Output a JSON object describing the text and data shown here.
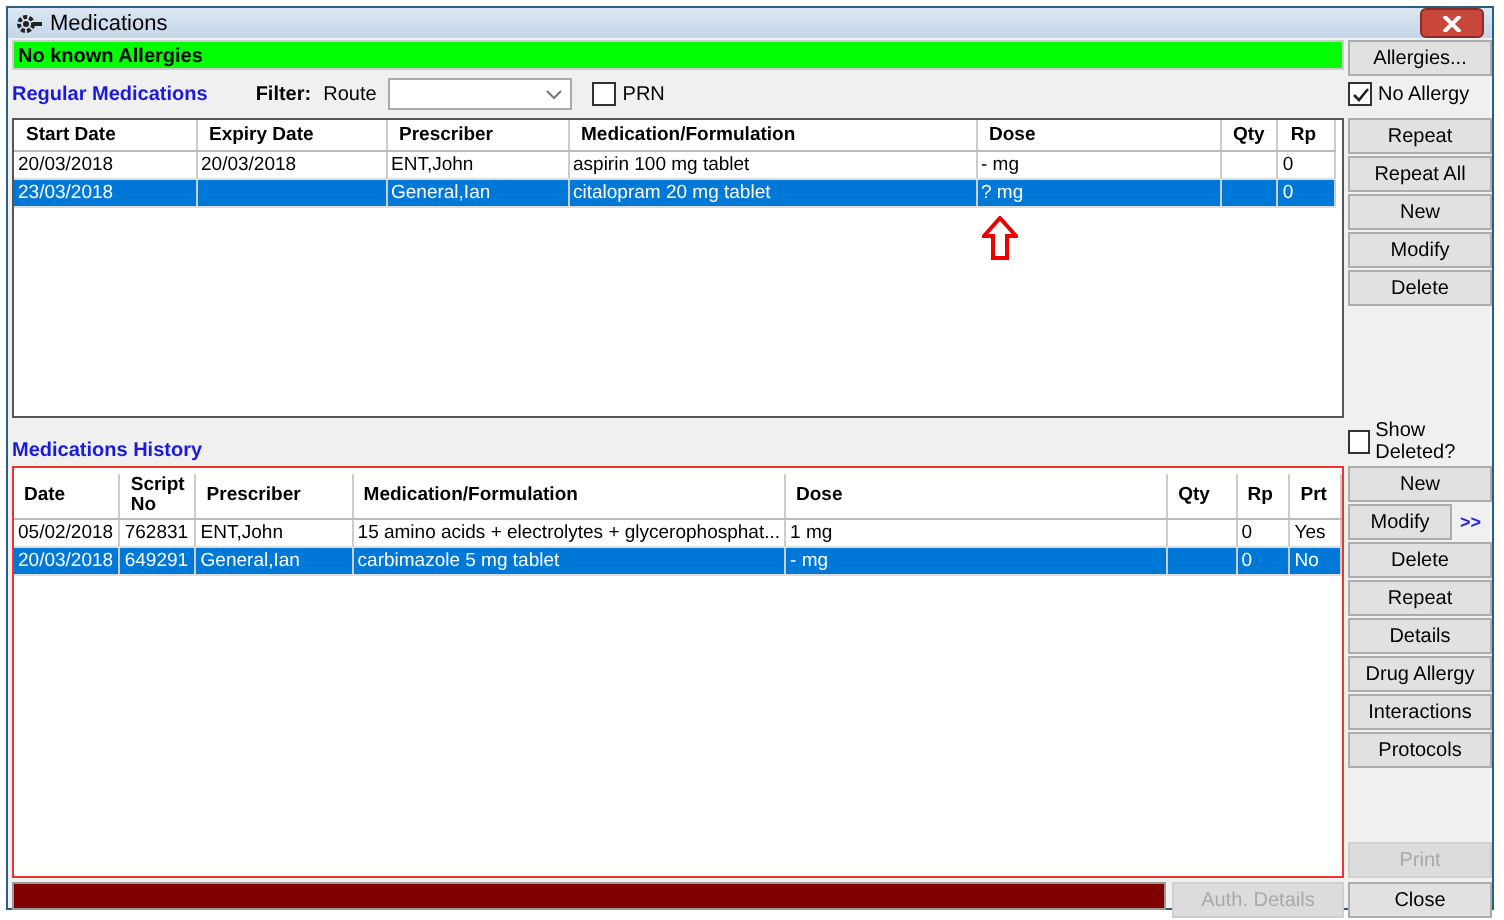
{
  "window": {
    "title": "Medications"
  },
  "allergy_status": "No known Allergies",
  "regular_medications": {
    "title": "Regular Medications",
    "filter_label": "Filter:",
    "route_label": "Route",
    "prn": {
      "label": "PRN",
      "checked": false
    },
    "columns": [
      "Start Date",
      "Expiry Date",
      "Prescriber",
      "Medication/Formulation",
      "Dose",
      "Qty",
      "Rp"
    ],
    "rows": [
      {
        "cells": [
          "20/03/2018",
          "20/03/2018",
          "ENT,John",
          "aspirin 100 mg tablet",
          "- mg",
          "",
          "0"
        ],
        "selected": false
      },
      {
        "cells": [
          "23/03/2018",
          "",
          "General,Ian",
          "citalopram 20 mg tablet",
          "? mg",
          "",
          "0"
        ],
        "selected": true
      }
    ]
  },
  "side_top": {
    "allergies_button": {
      "label": "Allergies...",
      "disabled": false
    },
    "no_allergy": {
      "label": "No Allergy",
      "checked": true
    },
    "buttons": [
      {
        "label": "Repeat",
        "disabled": false
      },
      {
        "label": "Repeat All",
        "disabled": false
      },
      {
        "label": "New",
        "disabled": false
      },
      {
        "label": "Modify",
        "disabled": false
      },
      {
        "label": "Delete",
        "disabled": false
      }
    ]
  },
  "medications_history": {
    "title": "Medications History",
    "show_deleted": {
      "label": "Show Deleted?",
      "checked": false
    },
    "columns": [
      "Date",
      "Script No",
      "Prescriber",
      "Medication/Formulation",
      "Dose",
      "Qty",
      "Rp",
      "Prt"
    ],
    "rows": [
      {
        "cells": [
          "05/02/2018",
          "762831",
          "ENT,John",
          "15 amino acids + electrolytes + glycerophosphat...",
          "1 mg",
          "",
          "0",
          "Yes"
        ],
        "selected": false
      },
      {
        "cells": [
          "20/03/2018",
          "649291",
          "General,Ian",
          "carbimazole 5 mg tablet",
          "- mg",
          "",
          "0",
          "No"
        ],
        "selected": true
      }
    ]
  },
  "side_bottom": {
    "buttons": [
      {
        "label": "New",
        "disabled": false
      },
      {
        "label": "Modify",
        "disabled": false,
        "more": ">>"
      },
      {
        "label": "Delete",
        "disabled": false
      },
      {
        "label": "Repeat",
        "disabled": false
      },
      {
        "label": "Details",
        "disabled": false
      },
      {
        "label": "Drug Allergy",
        "disabled": false
      },
      {
        "label": "Interactions",
        "disabled": false
      },
      {
        "label": "Protocols",
        "disabled": false
      }
    ],
    "print_button": {
      "label": "Print",
      "disabled": true
    }
  },
  "footer": {
    "auth_button": {
      "label": "Auth. Details",
      "disabled": true
    },
    "close_button": {
      "label": "Close",
      "disabled": false
    }
  }
}
